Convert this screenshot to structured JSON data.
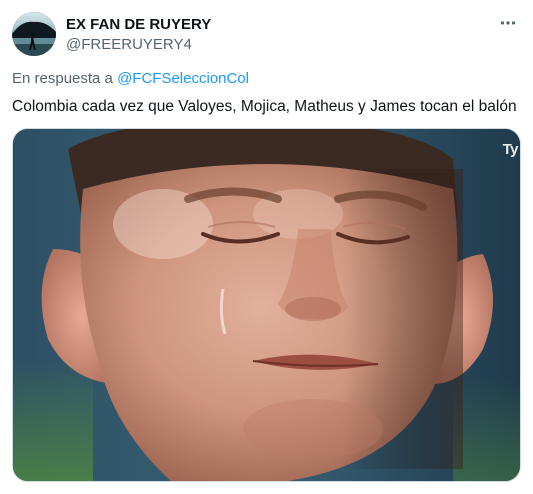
{
  "author": {
    "display_name": "EX FAN DE RUYERY",
    "handle": "@FREERUYERY4"
  },
  "reply": {
    "prefix": "En respuesta a",
    "mention": "@FCFSeleccionCol"
  },
  "tweet": {
    "text": "Colombia cada vez que Valoyes, Mojica, Matheus y James tocan el balón"
  },
  "media": {
    "watermark": "Ty"
  },
  "icons": {
    "more": "more-horizontal-icon"
  },
  "colors": {
    "text": "#0f1419",
    "secondary": "#536471",
    "link": "#1d9bf0",
    "border": "#cfd9de"
  }
}
